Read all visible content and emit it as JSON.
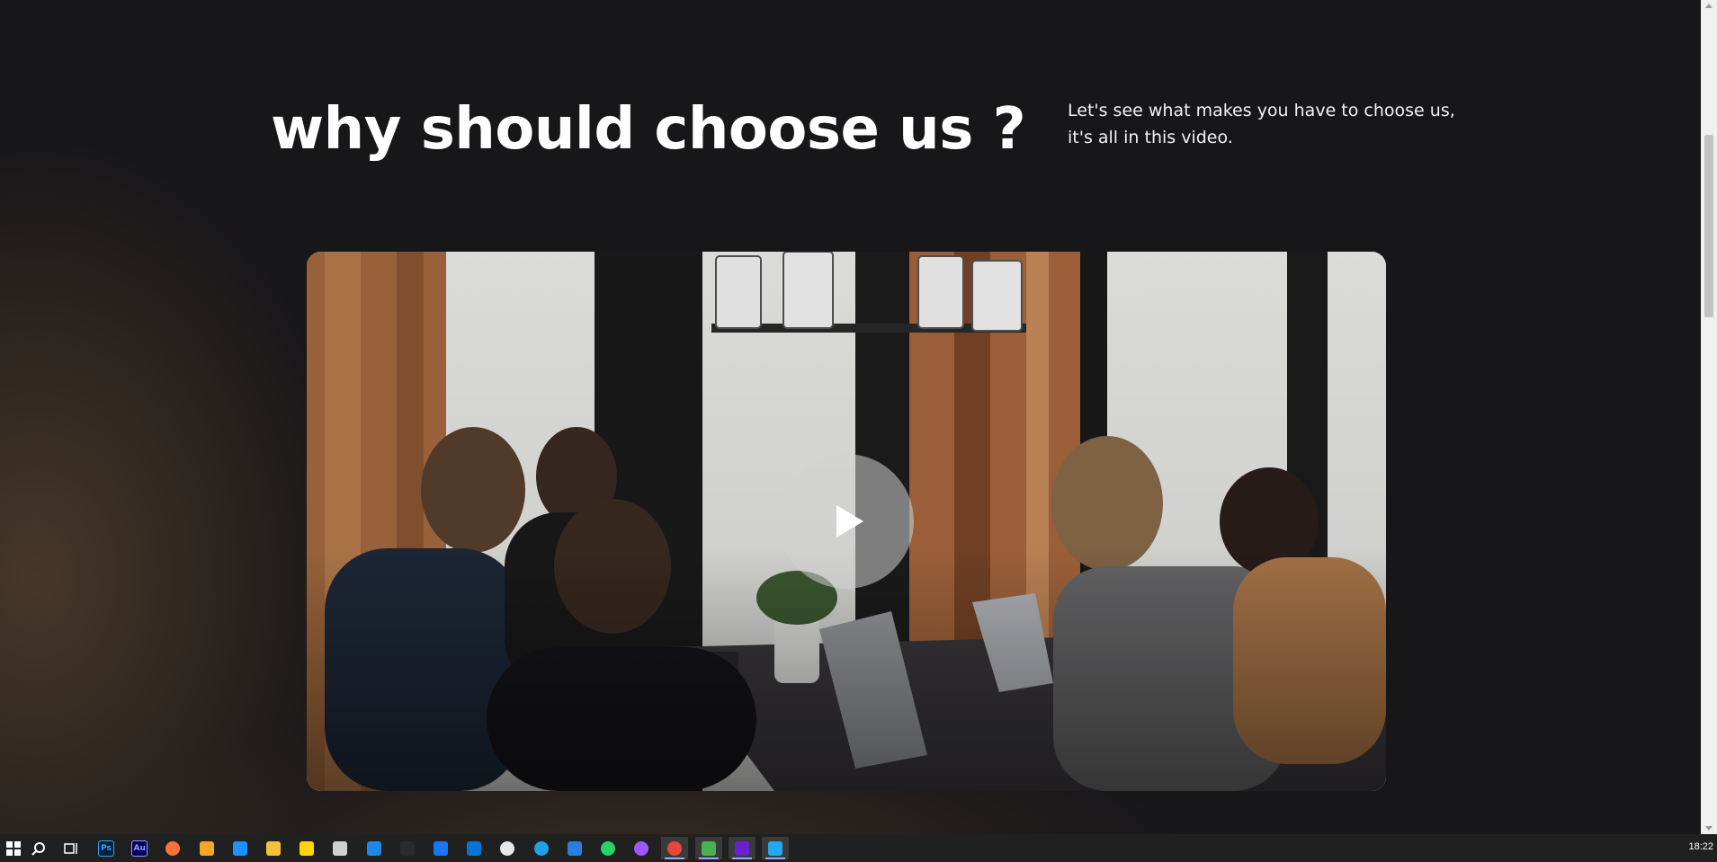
{
  "section": {
    "heading": "why should choose us ?",
    "intro_line1": "Let's see what makes you have to choose us,",
    "intro_line2": "it's all in this video."
  },
  "video": {
    "play_icon": "play-icon",
    "thumbnail": "team-meeting-photo"
  },
  "taskbar": {
    "clock": "18:22",
    "apps": [
      {
        "name": "start-icon"
      },
      {
        "name": "search-icon"
      },
      {
        "name": "task-view-icon"
      },
      {
        "name": "photoshop-icon",
        "label": "Ps",
        "color": "#31a8ff",
        "bg": "#001e36"
      },
      {
        "name": "audition-icon",
        "label": "Au",
        "color": "#9999ff",
        "bg": "#00005b"
      },
      {
        "name": "firefox-icon",
        "color": "#ff7139"
      },
      {
        "name": "search-app-icon",
        "color": "#f5a623"
      },
      {
        "name": "store-icon",
        "color": "#1e90ff"
      },
      {
        "name": "file-explorer-icon",
        "color": "#f3c13a"
      },
      {
        "name": "sticky-notes-icon",
        "color": "#ffd400"
      },
      {
        "name": "app-icon",
        "color": "#d0d0d0"
      },
      {
        "name": "webstorm-icon",
        "color": "#1e88e5"
      },
      {
        "name": "terminal-icon",
        "color": "#2b2b2b"
      },
      {
        "name": "facebook-icon",
        "color": "#1877f2"
      },
      {
        "name": "outlook-icon",
        "color": "#0a74d6"
      },
      {
        "name": "photos-icon",
        "color": "#e8e8e8"
      },
      {
        "name": "edge-icon",
        "color": "#1fa1e6"
      },
      {
        "name": "todo-icon",
        "color": "#2a7de1"
      },
      {
        "name": "whatsapp-icon",
        "color": "#25d366"
      },
      {
        "name": "messenger-icon",
        "color": "#9b59ff"
      },
      {
        "name": "chrome-icon",
        "color": "#e8453c",
        "active": true
      },
      {
        "name": "app-green-icon",
        "color": "#4caf50",
        "active": true
      },
      {
        "name": "media-player-icon",
        "color": "#6a1fd1",
        "active": true
      },
      {
        "name": "vscode-icon",
        "color": "#23a9f2",
        "active": true
      }
    ]
  }
}
